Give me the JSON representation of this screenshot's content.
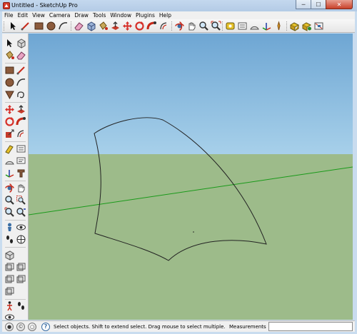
{
  "window": {
    "title": "Untitled - SketchUp Pro",
    "buttons": {
      "minimize": "─",
      "maximize": "☐",
      "close": "✕"
    }
  },
  "menubar": {
    "items": [
      "File",
      "Edit",
      "View",
      "Camera",
      "Draw",
      "Tools",
      "Window",
      "Plugins",
      "Help"
    ]
  },
  "toolbar": {
    "icons": [
      "select-icon",
      "line-icon",
      "rectangle-icon",
      "circle-icon",
      "arc-icon",
      "eraser-icon",
      "make-component-icon",
      "paint-bucket-icon",
      "push-pull-icon",
      "move-icon",
      "rotate-icon",
      "follow-me-icon",
      "offset-icon",
      "orbit-icon",
      "pan-icon",
      "zoom-icon",
      "zoom-extents-icon",
      "tape-measure-icon",
      "dimension-icon",
      "protractor-icon",
      "axes-icon",
      "add-location-icon",
      "get-models-icon",
      "share-model-icon",
      "extension-warehouse-icon",
      "layout-icon"
    ]
  },
  "palette": {
    "icons": [
      "select-icon",
      "make-component-icon",
      "paint-bucket-icon",
      "eraser-icon",
      "rectangle-icon",
      "line-icon",
      "circle-icon",
      "arc-icon",
      "polygon-icon",
      "freehand-icon",
      "move-icon",
      "push-pull-icon",
      "rotate-icon",
      "follow-me-icon",
      "scale-icon",
      "offset-icon",
      "tape-measure-icon",
      "dimension-icon",
      "protractor-icon",
      "text-icon",
      "axes-icon",
      "3d-text-icon",
      "orbit-icon",
      "pan-icon",
      "zoom-icon",
      "zoom-window-icon",
      "zoom-extents-icon",
      "previous-view-icon",
      "position-camera-icon",
      "walk-icon",
      "look-around-icon",
      "section-plane-icon",
      "iso-view-icon",
      "top-view-icon",
      "front-view-icon",
      "right-view-icon",
      "back-view-icon",
      "left-view-icon",
      "footprint-icon",
      "walk-figure-icon",
      "eye-icon"
    ]
  },
  "colors": {
    "sky_top": "#6ea6d3",
    "sky_bottom": "#a7d0ea",
    "ground": "#9dbb8a",
    "axis_green": "#1a9a1a"
  },
  "status": {
    "text": "Select objects. Shift to extend select. Drag mouse to select multiple.",
    "measurements_label": "Measurements",
    "measurements_value": ""
  }
}
